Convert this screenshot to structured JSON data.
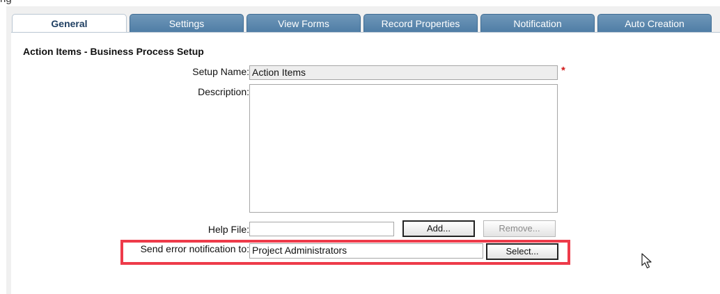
{
  "top_fragment": "ng",
  "tabs": [
    {
      "label": "General",
      "active": true
    },
    {
      "label": "Settings",
      "active": false
    },
    {
      "label": "View Forms",
      "active": false
    },
    {
      "label": "Record Properties",
      "active": false
    },
    {
      "label": "Notification",
      "active": false
    },
    {
      "label": "Auto Creation",
      "active": false
    }
  ],
  "heading": "Action Items - Business Process Setup",
  "setup_name": {
    "label": "Setup Name:",
    "value": "Action Items",
    "required_mark": "*"
  },
  "description": {
    "label": "Description:",
    "value": ""
  },
  "help_file": {
    "label": "Help File:",
    "value": "",
    "add_label": "Add...",
    "remove_label": "Remove..."
  },
  "send_error": {
    "label": "Send error notification to:",
    "value": "Project Administrators",
    "select_label": "Select..."
  },
  "colors": {
    "tab_blue": "#5a86ad",
    "highlight_red": "#ee3b4a",
    "required_red": "#d11a1a"
  }
}
